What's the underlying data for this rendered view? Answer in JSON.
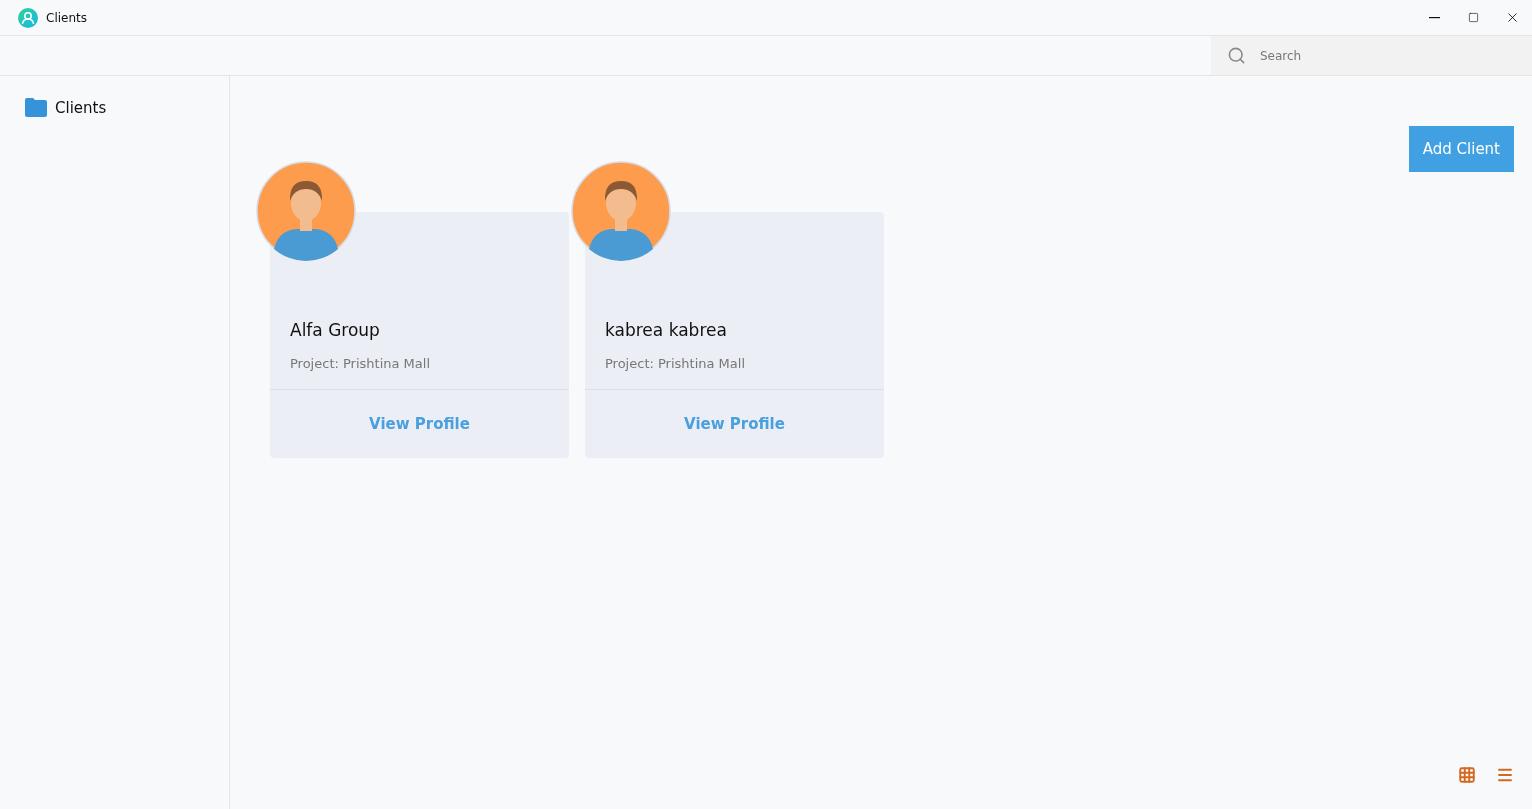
{
  "window": {
    "title": "Clients"
  },
  "search": {
    "placeholder": "Search"
  },
  "sidebar": {
    "items": [
      {
        "label": "Clients"
      }
    ]
  },
  "add_button": "Add Client",
  "clients": [
    {
      "name": "Alfa Group",
      "project": "Project: Prishtina Mall",
      "action": "View Profile"
    },
    {
      "name": "kabrea kabrea",
      "project": "Project: Prishtina Mall",
      "action": "View Profile"
    }
  ]
}
